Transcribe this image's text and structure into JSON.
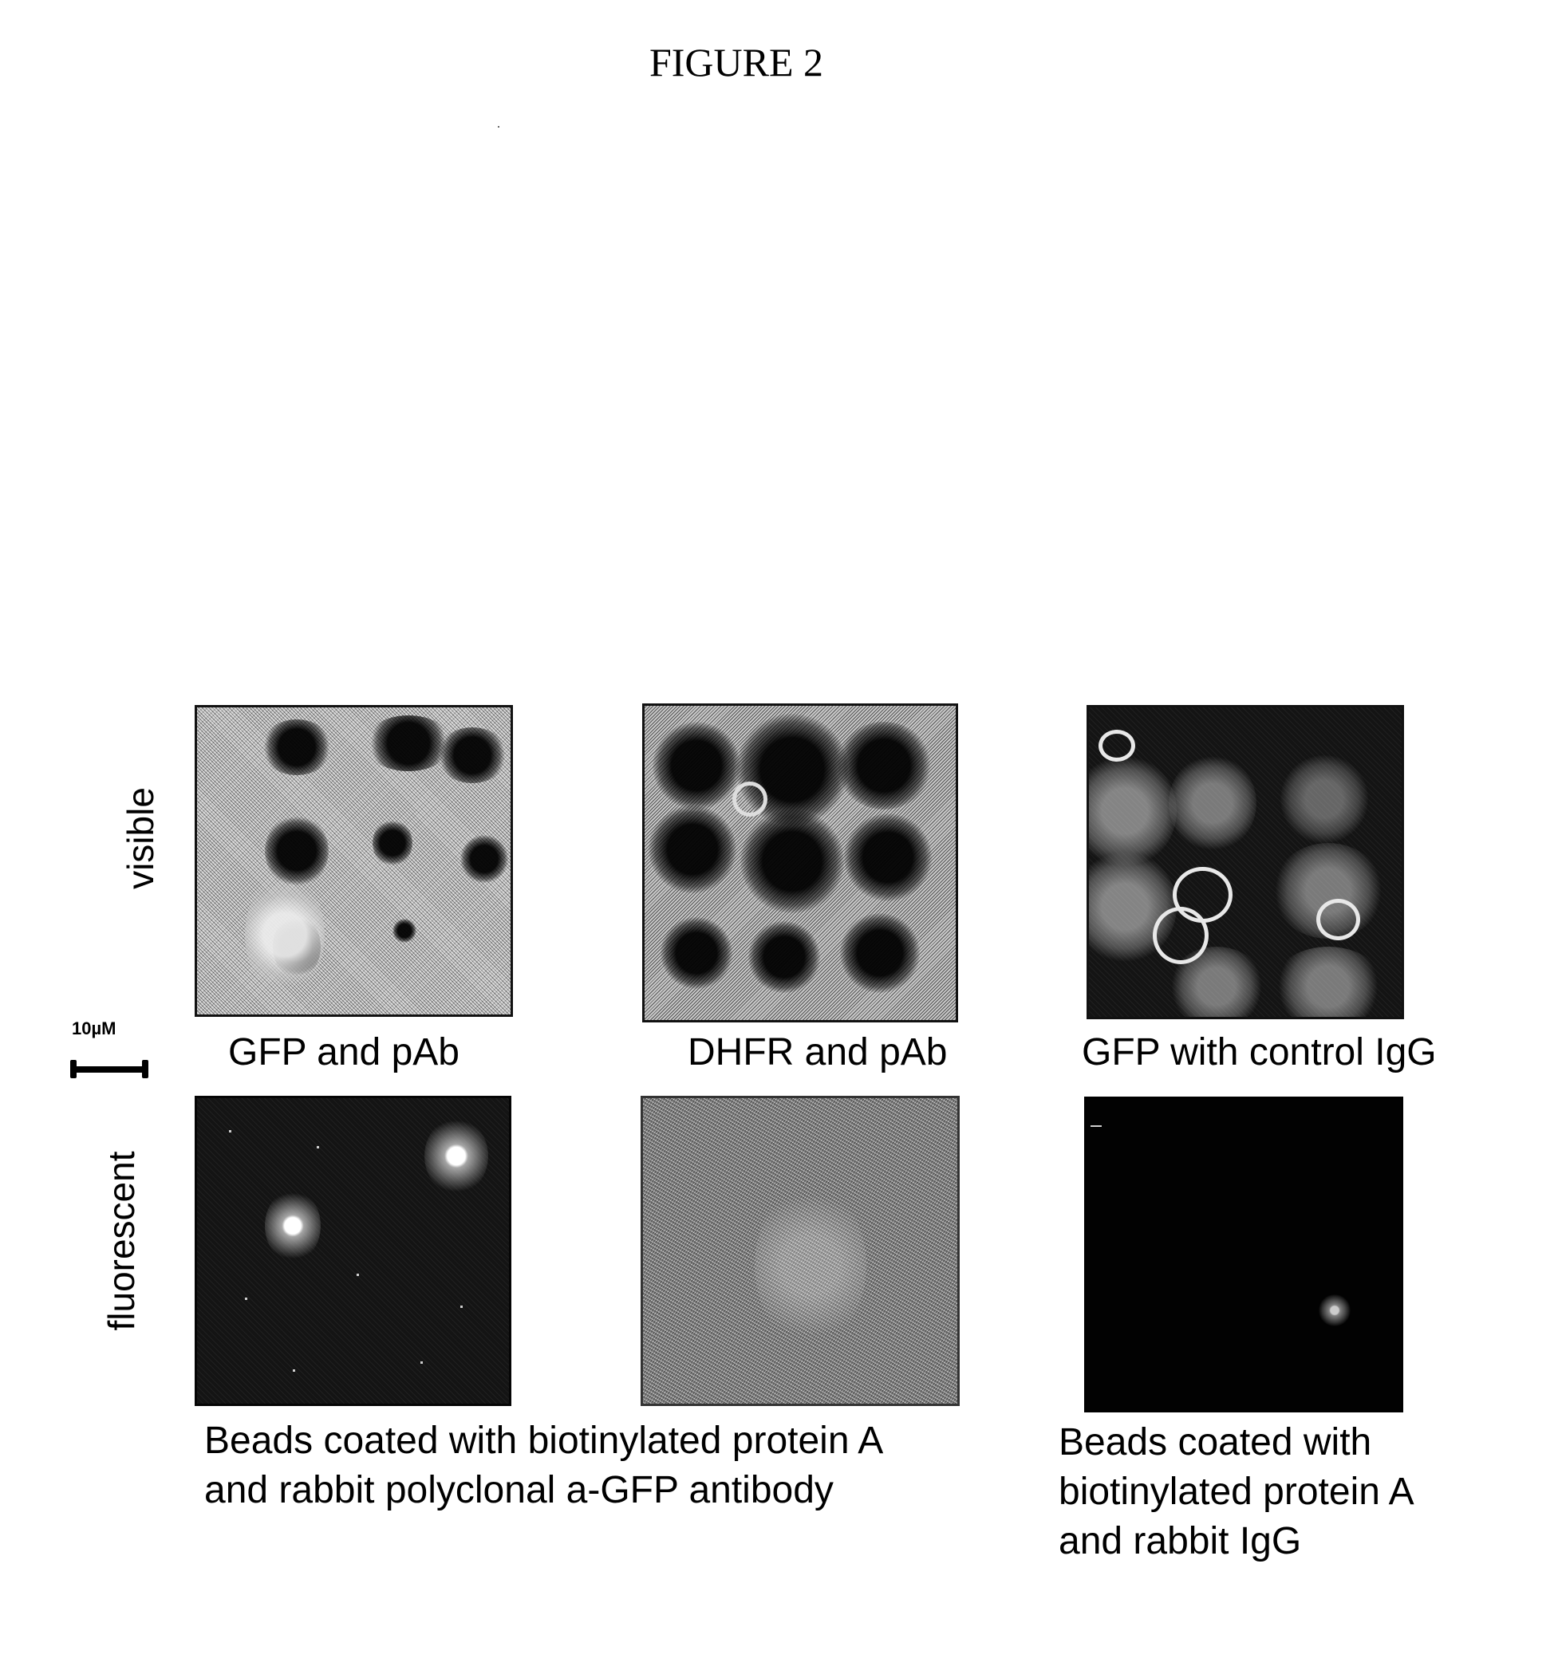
{
  "figure": {
    "title": "FIGURE 2"
  },
  "row_labels": {
    "top": "visible",
    "bottom": "fluorescent"
  },
  "scale_bar": {
    "label": "10µM"
  },
  "panels": [
    {
      "row": "visible",
      "column": 1,
      "caption": "GFP and pAb",
      "appearance": "light-field"
    },
    {
      "row": "visible",
      "column": 2,
      "caption": "DHFR and pAb",
      "appearance": "light-field"
    },
    {
      "row": "visible",
      "column": 3,
      "caption": "GFP with control IgG",
      "appearance": "dark-field"
    },
    {
      "row": "fluorescent",
      "column": 1,
      "appearance": "dark with two fluorescent beads"
    },
    {
      "row": "fluorescent",
      "column": 2,
      "appearance": "grey noise"
    },
    {
      "row": "fluorescent",
      "column": 3,
      "appearance": "black with one faint bead"
    }
  ],
  "bottom_captions": {
    "left": {
      "lines": [
        "Beads coated with biotinylated protein A",
        "and rabbit polyclonal a-GFP antibody"
      ]
    },
    "right": {
      "lines": [
        "Beads coated with",
        "biotinylated protein A",
        "and rabbit IgG"
      ]
    }
  }
}
